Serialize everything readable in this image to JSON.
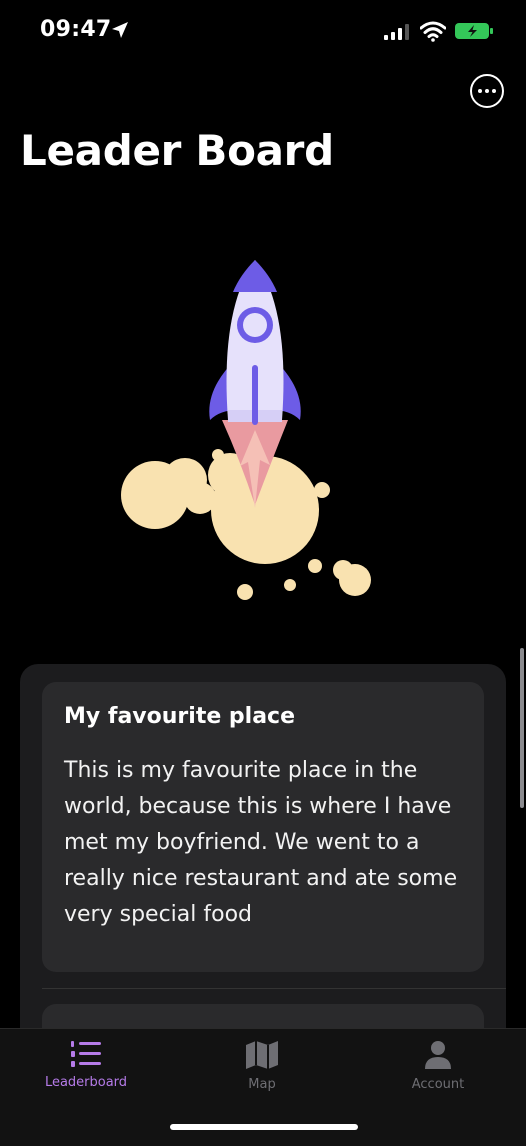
{
  "status_bar": {
    "time": "09:47"
  },
  "header": {
    "title": "Leader Board",
    "more_icon": "ellipsis-circle-icon"
  },
  "hero": {
    "icon": "rocket-illustration"
  },
  "card": {
    "title": "My favourite place",
    "body": "This is my favourite place in the world, because this is where I have met my boyfriend. We went to a really nice restaurant and ate some very special food"
  },
  "tab_bar": {
    "active_color": "#b57be8",
    "inactive_color": "#6e6e73",
    "tabs": [
      {
        "label": "Leaderboard",
        "icon": "list-numbered-icon",
        "active": true
      },
      {
        "label": "Map",
        "icon": "map-icon",
        "active": false
      },
      {
        "label": "Account",
        "icon": "person-icon",
        "active": false
      }
    ]
  },
  "colors": {
    "rocket_purple": "#6d5ce6",
    "rocket_body": "#e6e1fb",
    "flame_pink": "#e99aa0",
    "smoke_cream": "#f9e2b0"
  }
}
